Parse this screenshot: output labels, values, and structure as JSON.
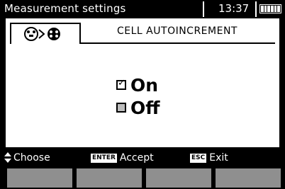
{
  "header": {
    "title": "Measurement settings",
    "time": "13:37",
    "battery_icon": "battery-full-icon"
  },
  "tab": {
    "icon": "probe-connector-icon",
    "label": "CELL AUTOINCREMENT"
  },
  "options": [
    {
      "label": "On",
      "checked": true
    },
    {
      "label": "Off",
      "checked": false
    }
  ],
  "footer": {
    "choose_label": "Choose",
    "accept_key": "ENTER",
    "accept_label": "Accept",
    "exit_key": "ESC",
    "exit_label": "Exit"
  },
  "colors": {
    "background": "#000000",
    "content": "#ffffff",
    "softkey": "#8f8f8f"
  }
}
